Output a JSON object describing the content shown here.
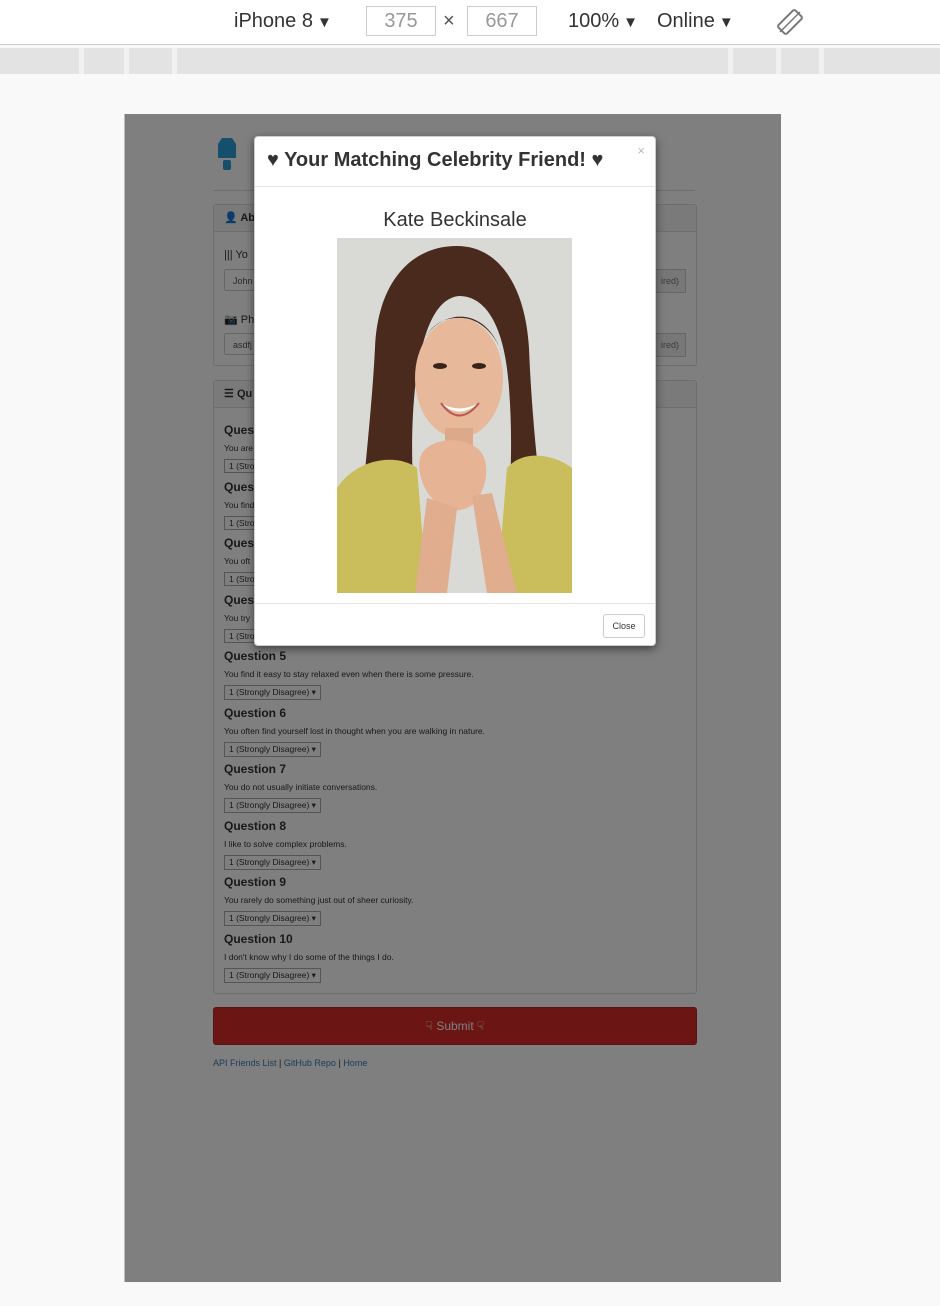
{
  "devtools": {
    "device": "iPhone 8",
    "width": "375",
    "height": "667",
    "x_sep": "×",
    "zoom": "100%",
    "network": "Online",
    "caret": "▼"
  },
  "app": {
    "about_heading": "Abo",
    "name_label": "Yo",
    "name_value": "John",
    "name_hint": "ired)",
    "photo_label": "Ph",
    "photo_value": "asdfj",
    "photo_hint": "ired)",
    "questions_heading": "Qu",
    "questions": [
      {
        "title": "Ques",
        "text": "You are",
        "select": "1 (Stro"
      },
      {
        "title": "Ques",
        "text": "You find",
        "select": "1 (Stro"
      },
      {
        "title": "Ques",
        "text": "You oft",
        "select": "1 (Stro"
      },
      {
        "title": "Ques",
        "text": "You try",
        "select": "1 (Stro"
      },
      {
        "title": "Question 5",
        "text": "You find it easy to stay relaxed even when there is some pressure.",
        "select": "1 (Strongly Disagree) ▾"
      },
      {
        "title": "Question 6",
        "text": "You often find yourself lost in thought when you are walking in nature.",
        "select": "1 (Strongly Disagree) ▾"
      },
      {
        "title": "Question 7",
        "text": "You do not usually initiate conversations.",
        "select": "1 (Strongly Disagree) ▾"
      },
      {
        "title": "Question 8",
        "text": "I like to solve complex problems.",
        "select": "1 (Strongly Disagree) ▾"
      },
      {
        "title": "Question 9",
        "text": "You rarely do something just out of sheer curiosity.",
        "select": "1 (Strongly Disagree) ▾"
      },
      {
        "title": "Question 10",
        "text": "I don't know why I do some of the things I do.",
        "select": "1 (Strongly Disagree) ▾"
      }
    ],
    "submit_label": "☟ Submit ☟",
    "footer": {
      "link1": "API Friends List",
      "link2": "GitHub Repo",
      "link3": "Home",
      "sep": "|"
    }
  },
  "modal": {
    "heart": "♥",
    "title": "Your Matching Celebrity Friend!",
    "close_x": "×",
    "friend_name": "Kate Beckinsale",
    "close_label": "Close"
  },
  "colors": {
    "submit": "#d62a2a",
    "link": "#337ab7",
    "logo": "#2a9fd6"
  }
}
